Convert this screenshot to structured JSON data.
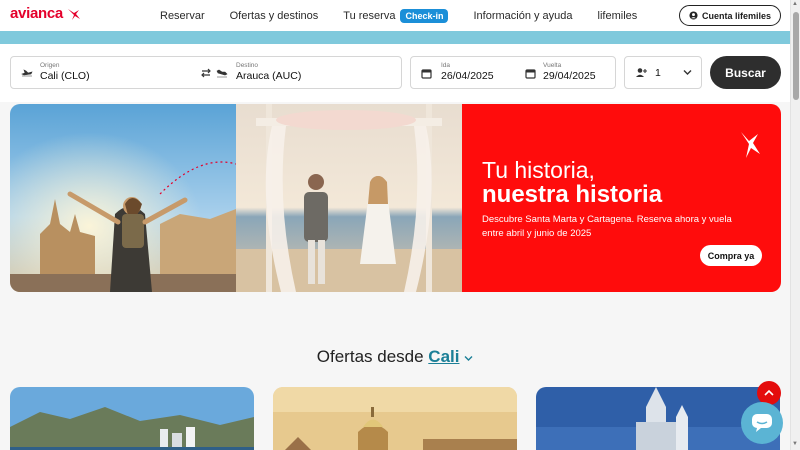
{
  "brand": {
    "name": "avianca",
    "color": "#e4002b"
  },
  "nav": {
    "items": [
      {
        "label": "Reservar"
      },
      {
        "label": "Ofertas y destinos"
      },
      {
        "label": "Tu reserva",
        "badge": "Check-in"
      },
      {
        "label": "Información y ayuda"
      },
      {
        "label": "lifemiles"
      }
    ],
    "account_label": "Cuenta lifemiles"
  },
  "search": {
    "origin_label": "Origen",
    "origin_value": "Cali  (CLO)",
    "destination_label": "Destino",
    "destination_value": "Arauca  (AUC)",
    "depart_label": "Ida",
    "depart_value": "26/04/2025",
    "return_label": "Vuelta",
    "return_value": "29/04/2025",
    "passengers_value": "1",
    "search_label": "Buscar"
  },
  "hero": {
    "title_line1": "Tu historia,",
    "title_line2": "nuestra historia",
    "description": "Descubre Santa Marta y Cartagena. Reserva ahora y vuela entre abril y junio de 2025",
    "cta_label": "Compra ya",
    "accent_color": "#ff0c0c"
  },
  "offers": {
    "title_prefix": "Ofertas desde",
    "city": "Cali"
  },
  "icons": [
    "plane-takeoff-icon",
    "swap-icon",
    "plane-landing-icon",
    "calendar-icon",
    "person-add-icon",
    "chevron-down-icon",
    "user-icon",
    "arrow-up-icon",
    "chat-icon"
  ]
}
